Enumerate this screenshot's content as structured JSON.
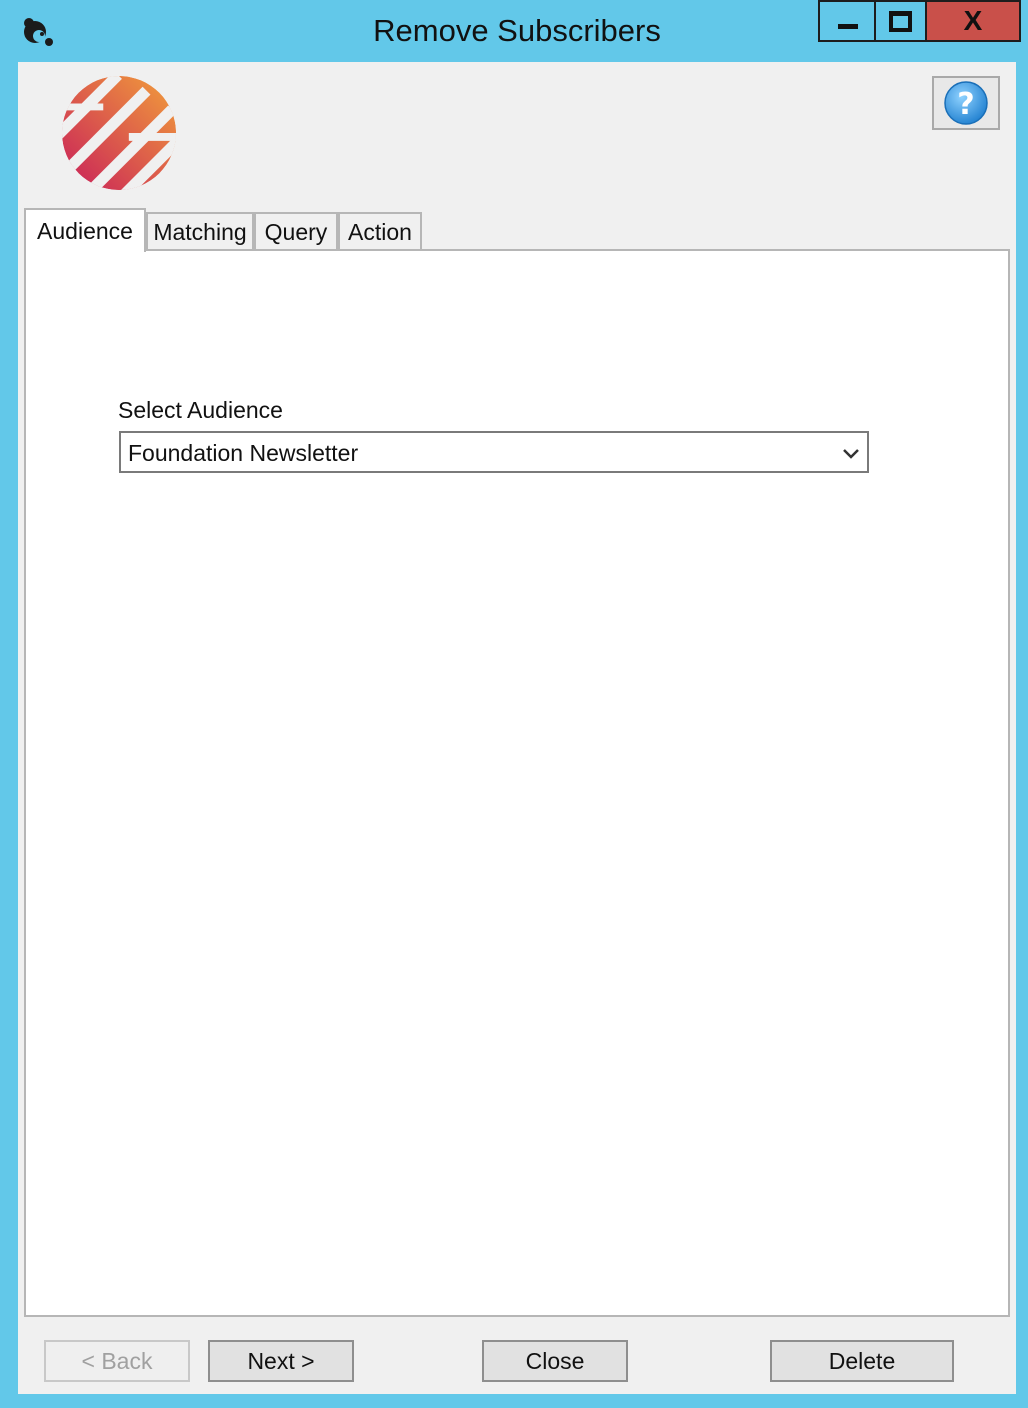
{
  "window": {
    "title": "Remove Subscribers",
    "app_icon": "chimp-icon",
    "controls": [
      "minimize-icon",
      "maximize-icon",
      "close-icon"
    ],
    "close_glyph": "X"
  },
  "header": {
    "logo": "brand-logo",
    "help_glyph": "?",
    "help_icon": "help-icon",
    "colors": {
      "logo_start": "#c81e5a",
      "logo_end": "#f2a03a",
      "help": "#2a8fd8"
    }
  },
  "tabs": [
    {
      "label": "Audience",
      "active": true
    },
    {
      "label": "Matching",
      "active": false
    },
    {
      "label": "Query",
      "active": false
    },
    {
      "label": "Action",
      "active": false
    }
  ],
  "audience": {
    "label": "Select Audience",
    "selected": "Foundation Newsletter"
  },
  "footer": {
    "back_label": "< Back",
    "next_label": "Next >",
    "close_label": "Close",
    "delete_label": "Delete"
  },
  "colors": {
    "titlebar": "#62c8e9",
    "close_button": "#c9504a",
    "client_background": "#f0f0f0"
  }
}
